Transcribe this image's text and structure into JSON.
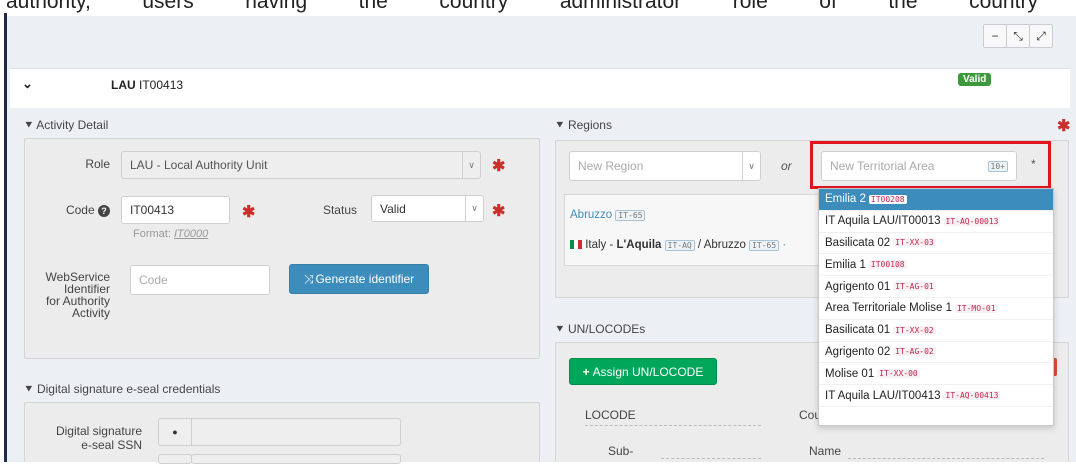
{
  "doc_text": [
    "authority,",
    "users",
    "having",
    "the",
    "country",
    "administrator",
    "role",
    "of",
    "the",
    "country"
  ],
  "toolbar": {
    "minimize": "−",
    "shrink": "⤡",
    "expand": "⤢"
  },
  "header": {
    "prefix": "LAU",
    "code": "IT00413",
    "badge": "Valid"
  },
  "activity": {
    "title": "Activity Detail",
    "role_label": "Role",
    "role_value": "LAU - Local Authority Unit",
    "code_label": "Code",
    "code_value": "IT00413",
    "format_hint_prefix": "Format: ",
    "format_hint_value": "IT0000",
    "status_label": "Status",
    "status_value": "Valid",
    "ws_label_1": "WebService",
    "ws_label_2": "Identifier",
    "ws_label_3": "for Authority",
    "ws_label_4": "Activity",
    "ws_placeholder": "Code",
    "generate_label": "Generate identifier"
  },
  "signature": {
    "title": "Digital signature e-seal credentials",
    "ssn_label_1": "Digital signature",
    "ssn_label_2": "e-seal SSN"
  },
  "regions": {
    "title": "Regions",
    "new_region_placeholder": "New Region",
    "or_label": "or",
    "new_area_placeholder": "New Territorial Area",
    "area_badge": "10+",
    "region_name": "Abruzzo",
    "region_tag": "IT-65",
    "country": "Italy",
    "sep": " - ",
    "place": "L'Aquila",
    "place_tag": "IT-AQ",
    "slash": " / ",
    "region_again": "Abruzzo",
    "region_again_tag": "IT-65"
  },
  "dropdown_items": [
    {
      "name": "Emilia 2",
      "tag": "IT00208",
      "active": true
    },
    {
      "name": "IT Aquila LAU/IT00013",
      "tag": "IT-AQ-00013"
    },
    {
      "name": "Basilicata 02",
      "tag": "IT-XX-03"
    },
    {
      "name": "Emilia 1",
      "tag": "IT00108"
    },
    {
      "name": "Agrigento 01",
      "tag": "IT-AG-01"
    },
    {
      "name": "Area Territoriale Molise 1",
      "tag": "IT-MO-01"
    },
    {
      "name": "Basilicata 01",
      "tag": "IT-XX-02"
    },
    {
      "name": "Agrigento 02",
      "tag": "IT-AG-02"
    },
    {
      "name": "Molise 01",
      "tag": "IT-XX-00"
    },
    {
      "name": "IT Aquila LAU/IT00413",
      "tag": "IT-AQ-00413"
    }
  ],
  "unlocodes": {
    "title": "UN/LOCODEs",
    "assign_label": "Assign UN/LOCODE",
    "locode_label": "LOCODE",
    "country_label_partial": "Cou",
    "sub_label": "Sub-",
    "name_label": "Name"
  },
  "colors": {
    "accent": "#3c8dbc",
    "success": "#00a65a",
    "danger": "#c9302c",
    "highlight": "#e0161d"
  }
}
